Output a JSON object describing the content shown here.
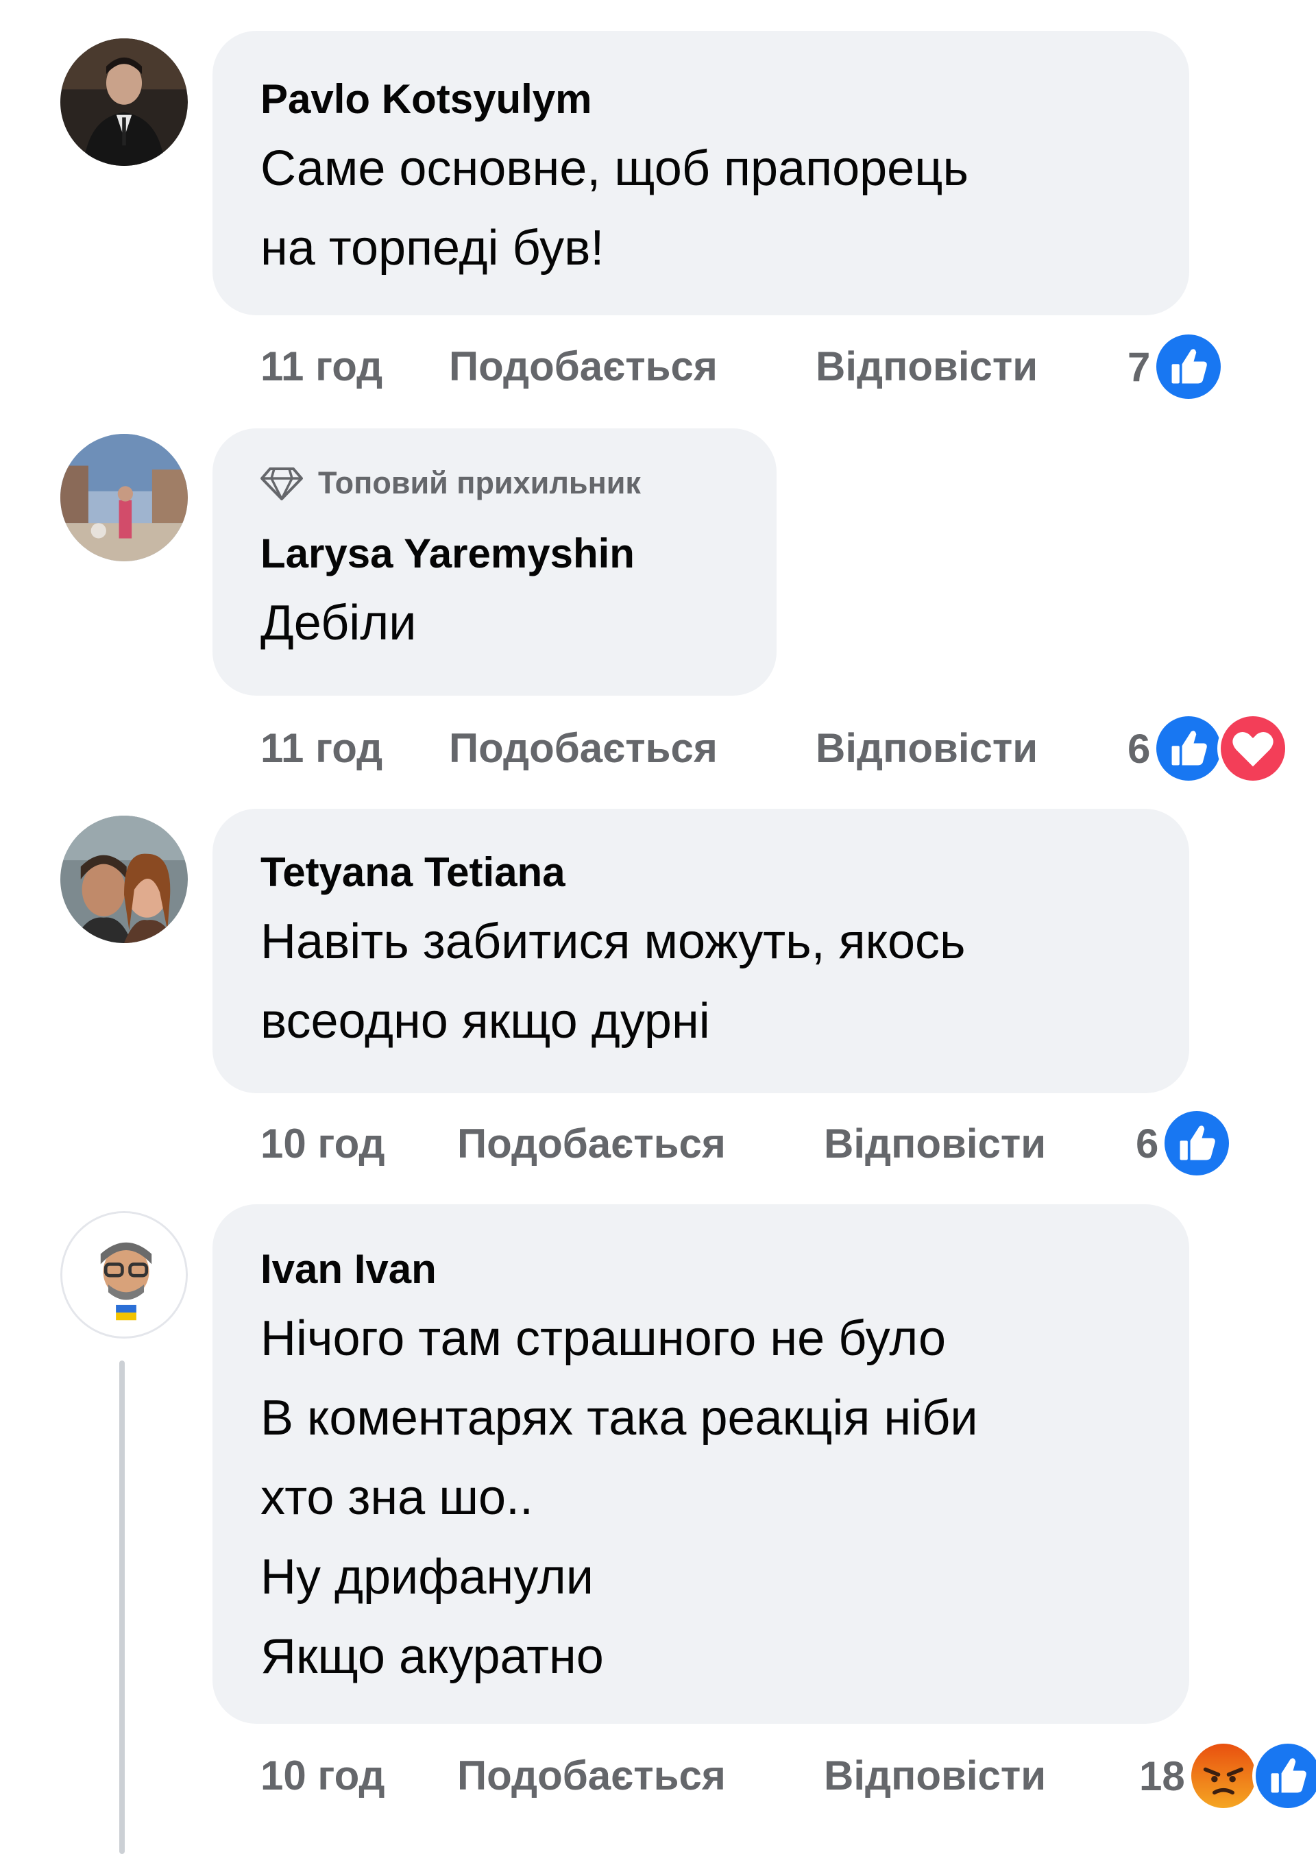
{
  "comments": [
    {
      "author": "Pavlo Kotsyulym",
      "badge": "",
      "lines": [
        "Саме основне, щоб прапорець",
        "на торпеді був!"
      ],
      "time": "11 год",
      "like_label": "Подобається",
      "reply_label": "Відповісти",
      "reaction_count": "7",
      "reactions": [
        "like-icon"
      ]
    },
    {
      "author": "Larysa Yaremyshin",
      "badge": "Топовий прихильник",
      "badge_icon": "diamond-icon",
      "lines": [
        "Дебіли"
      ],
      "time": "11 год",
      "like_label": "Подобається",
      "reply_label": "Відповісти",
      "reaction_count": "6",
      "reactions": [
        "like-icon",
        "love-icon"
      ]
    },
    {
      "author": "Tetyana Tetiana",
      "badge": "",
      "lines": [
        "Навіть забитися можуть, якось",
        "всеодно якщо дурні"
      ],
      "time": "10 год",
      "like_label": "Подобається",
      "reply_label": "Відповісти",
      "reaction_count": "6",
      "reactions": [
        "like-icon"
      ]
    },
    {
      "author": "Ivan Ivan",
      "badge": "",
      "lines": [
        "Нічого там страшного не було",
        "В коментарях така реакція ніби",
        "хто зна шо..",
        "Ну дрифанули",
        "Якщо акуратно"
      ],
      "time": "10 год",
      "like_label": "Подобається",
      "reply_label": "Відповісти",
      "reaction_count": "18",
      "reactions": [
        "angry-icon",
        "like-icon"
      ]
    }
  ],
  "colors": {
    "bubble": "#f0f2f5",
    "secondary_text": "#65676b",
    "like_blue": "#1877f2",
    "love_red": "#f33e58",
    "angry_orange": "#e9710f"
  }
}
